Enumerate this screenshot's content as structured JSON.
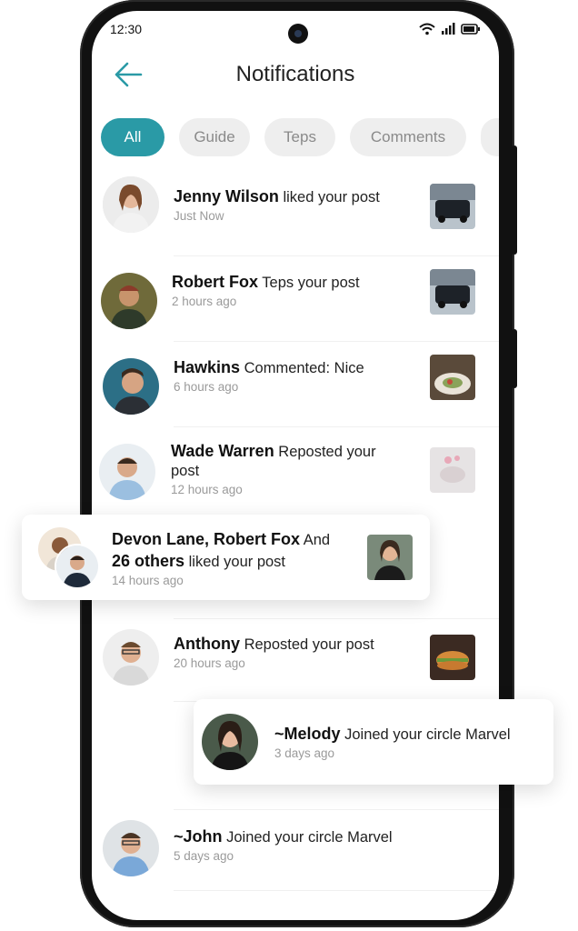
{
  "status": {
    "time": "12:30"
  },
  "header": {
    "title": "Notifications"
  },
  "tabs": [
    {
      "label": "All",
      "active": true
    },
    {
      "label": "Guide"
    },
    {
      "label": "Teps"
    },
    {
      "label": "Comments"
    }
  ],
  "notifications": [
    {
      "name": "Jenny Wilson",
      "action": " liked your post",
      "time": "Just Now"
    },
    {
      "name": "Robert Fox",
      "action": " Teps your post",
      "time": "2 hours ago"
    },
    {
      "name": "Hawkins",
      "action": " Commented: Nice",
      "time": "6 hours ago"
    },
    {
      "name": "Wade Warren",
      "action": " Reposted your post",
      "time": "12 hours ago"
    },
    {
      "name": "Devon Lane, Robert Fox",
      "action": " And",
      "name2": "26 others",
      "action2": " liked your post",
      "time": "14 hours ago"
    },
    {
      "name": "Anthony",
      "action": " Reposted your post",
      "time": "20 hours ago"
    },
    {
      "name": "~Melody",
      "action": " Joined your circle Marvel",
      "time": "3 days ago"
    },
    {
      "name": "~John",
      "action": " Joined your circle Marvel",
      "time": "5 days ago"
    }
  ],
  "colors": {
    "accent": "#2a9aa6"
  }
}
